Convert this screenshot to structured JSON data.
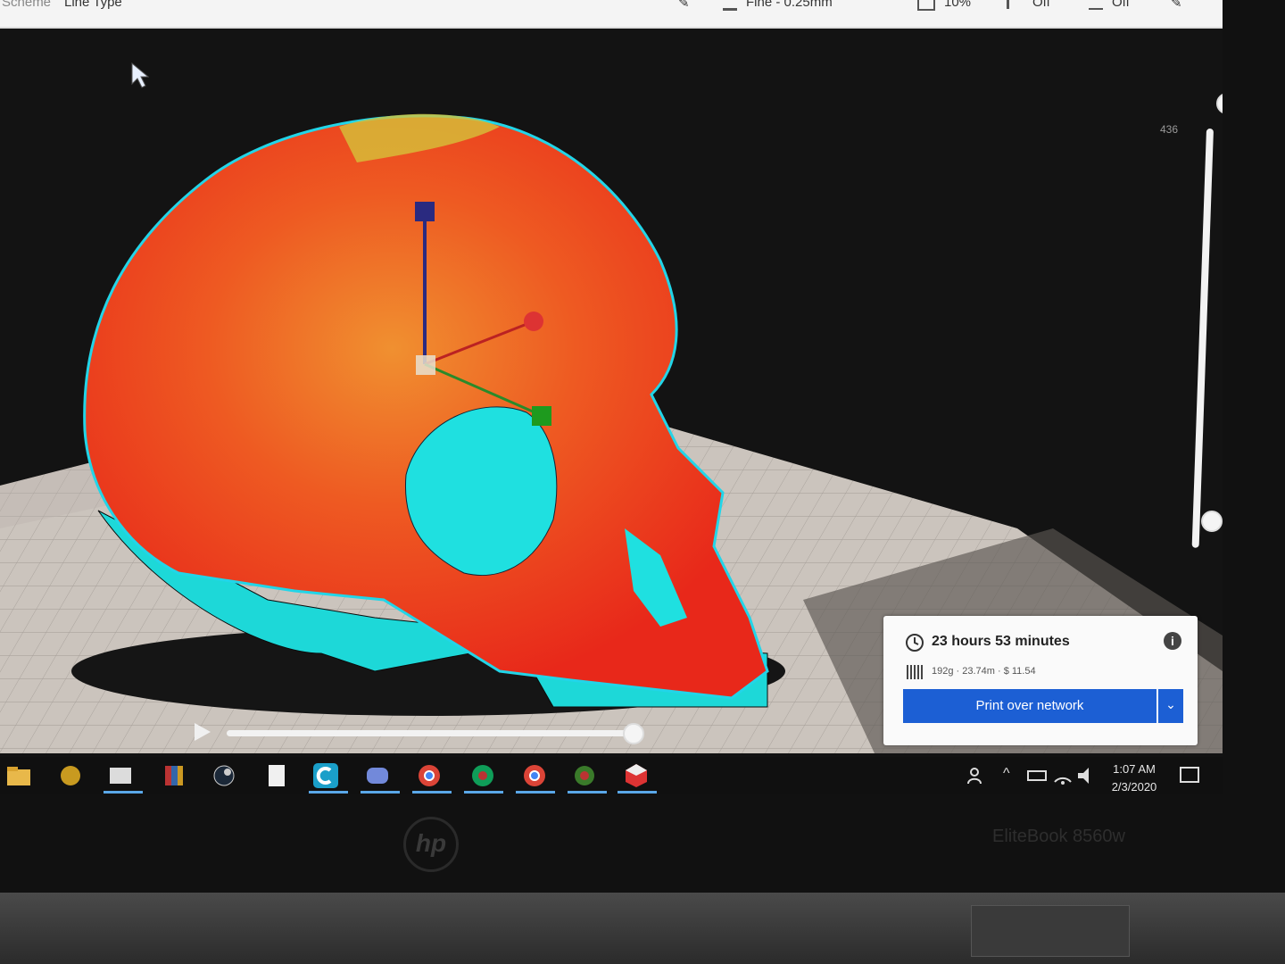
{
  "toolbar": {
    "scheme_label": "Scheme",
    "scheme_value": "Line Type",
    "profile": "Fine - 0.25mm",
    "infill": "10%",
    "support": "Off",
    "adhesion": "Off"
  },
  "viewer": {
    "layer_number": "436"
  },
  "print_panel": {
    "time": "23 hours 53 minutes",
    "material": "192g · 23.74m · $ 11.54",
    "print_button": "Print over network",
    "info_icon": "i"
  },
  "taskbar": {
    "apps": [
      "file-explorer-icon",
      "app-icon",
      "paint-icon",
      "winrar-icon",
      "steam-icon",
      "document-icon",
      "cura-icon",
      "discord-icon",
      "chrome-icon",
      "chrome-profile-icon",
      "chrome-profile-2-icon",
      "app-icon-2",
      "cube-app-icon"
    ],
    "time": "1:07 AM",
    "date": "2/3/2020"
  },
  "laptop": {
    "brand": "hp",
    "model": "EliteBook 8560w"
  },
  "colors": {
    "accent_blue": "#1c5fd4",
    "model_red": "#e8301a",
    "model_cyan": "#1ee0e0",
    "bed": "#c9c2bc"
  }
}
